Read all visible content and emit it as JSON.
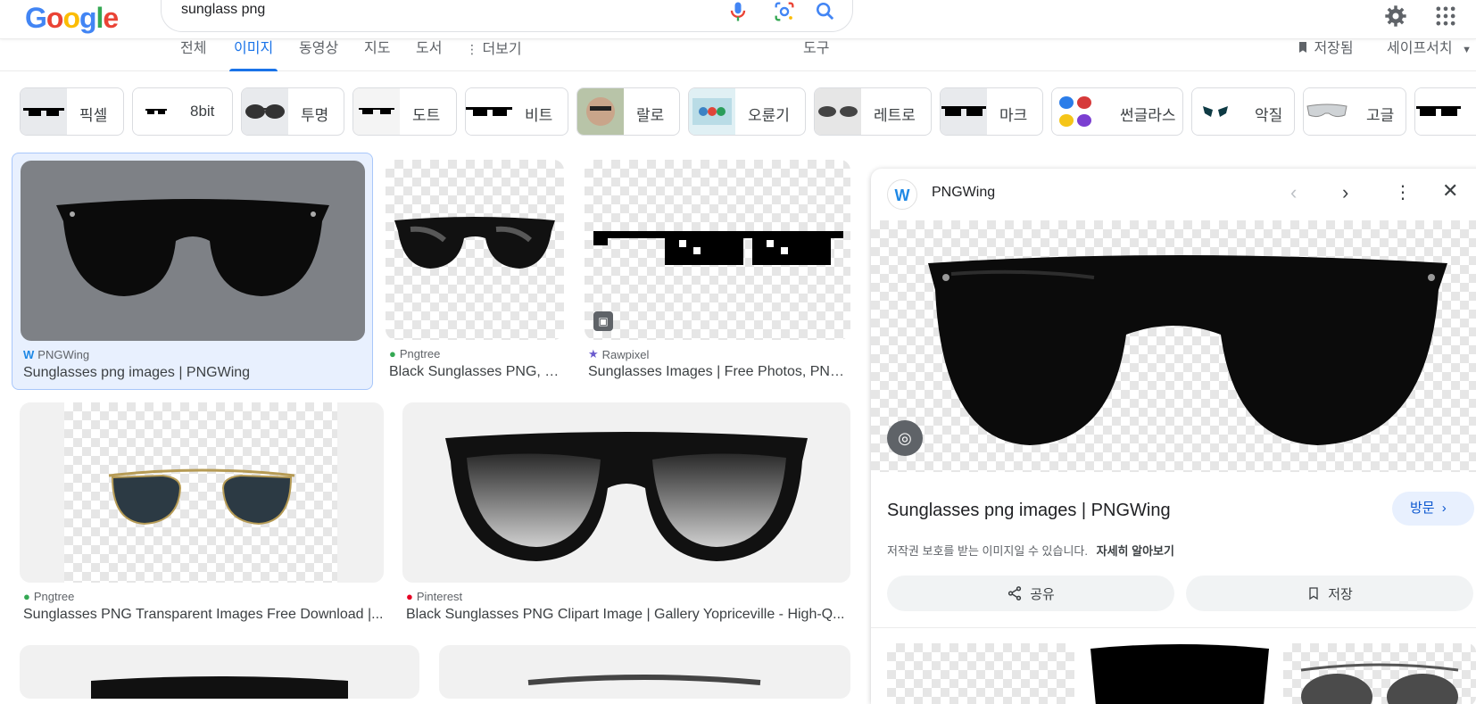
{
  "search": {
    "query": "sunglass png"
  },
  "logo": {
    "letters": [
      "G",
      "o",
      "o",
      "g",
      "l",
      "e"
    ],
    "colors": [
      "#4285f4",
      "#ea4335",
      "#fbbc05",
      "#4285f4",
      "#34a853",
      "#ea4335"
    ]
  },
  "tabs": [
    "전체",
    "이미지",
    "동영상",
    "지도",
    "도서",
    "더보기"
  ],
  "tools_label": "도구",
  "saved_label": "저장됨",
  "safesearch_label": "세이프서치",
  "chips": [
    "픽셀",
    "8bit",
    "투명",
    "도트",
    "비트",
    "랄로",
    "오륜기",
    "레트로",
    "마크",
    "썬글라스",
    "악질",
    "고글"
  ],
  "results": [
    {
      "source": "PNGWing",
      "title": "Sunglasses png images | PNGWing"
    },
    {
      "source": "Pngtree",
      "title": "Black Sunglasses PNG, V..."
    },
    {
      "source": "Rawpixel",
      "title": "Sunglasses Images | Free Photos, PNG..."
    },
    {
      "source": "Pngtree",
      "title": "Sunglasses PNG Transparent Images Free Download |..."
    },
    {
      "source": "Pinterest",
      "title": "Black Sunglasses PNG Clipart Image | Gallery Yopriceville - High-Q..."
    }
  ],
  "panel": {
    "source": "PNGWing",
    "title": "Sunglasses png images | PNGWing",
    "visit_label": "방문",
    "copyright_note": "저작권 보호를 받는 이미지일 수 있습니다.",
    "learn_more": "자세히 알아보기",
    "share_label": "공유",
    "save_label": "저장"
  },
  "colors": {
    "accent": "#1a73e8",
    "selected_bg": "#e8f0fe"
  }
}
